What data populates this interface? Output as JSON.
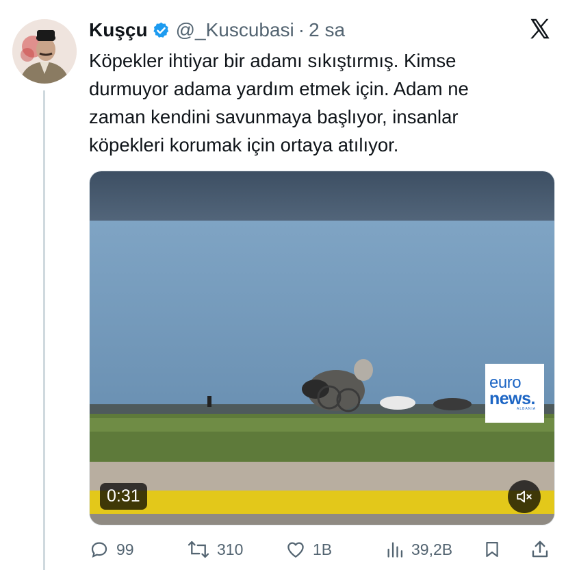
{
  "user": {
    "name": "Kuşçu",
    "handle": "@_Kuscubasi",
    "separator": "·",
    "time": "2 sa"
  },
  "tweet": {
    "lines": [
      "Köpekler ihtiyar bir adamı sıkıştırmış. Kimse",
      "durmuyor adama yardım etmek için. Adam ne",
      "zaman kendini savunmaya başlıyor, insanlar",
      "köpekleri korumak için ortaya atılıyor."
    ]
  },
  "media": {
    "duration": "0:31",
    "watermark": {
      "line1": "euro",
      "line2": "news.",
      "line3": "ALBANIA"
    }
  },
  "actions": {
    "replies": "99",
    "reposts": "310",
    "likes": "1B",
    "views": "39,2B"
  },
  "icons": {
    "verified": "verified-badge-icon",
    "platform": "x-logo-icon",
    "reply": "reply-icon",
    "repost": "repost-icon",
    "like": "heart-icon",
    "views": "views-chart-icon",
    "bookmark": "bookmark-icon",
    "share": "share-icon",
    "mute": "muted-speaker-icon"
  },
  "colors": {
    "text": "#0f1419",
    "secondary": "#536471",
    "verified": "#1d9bf0"
  }
}
